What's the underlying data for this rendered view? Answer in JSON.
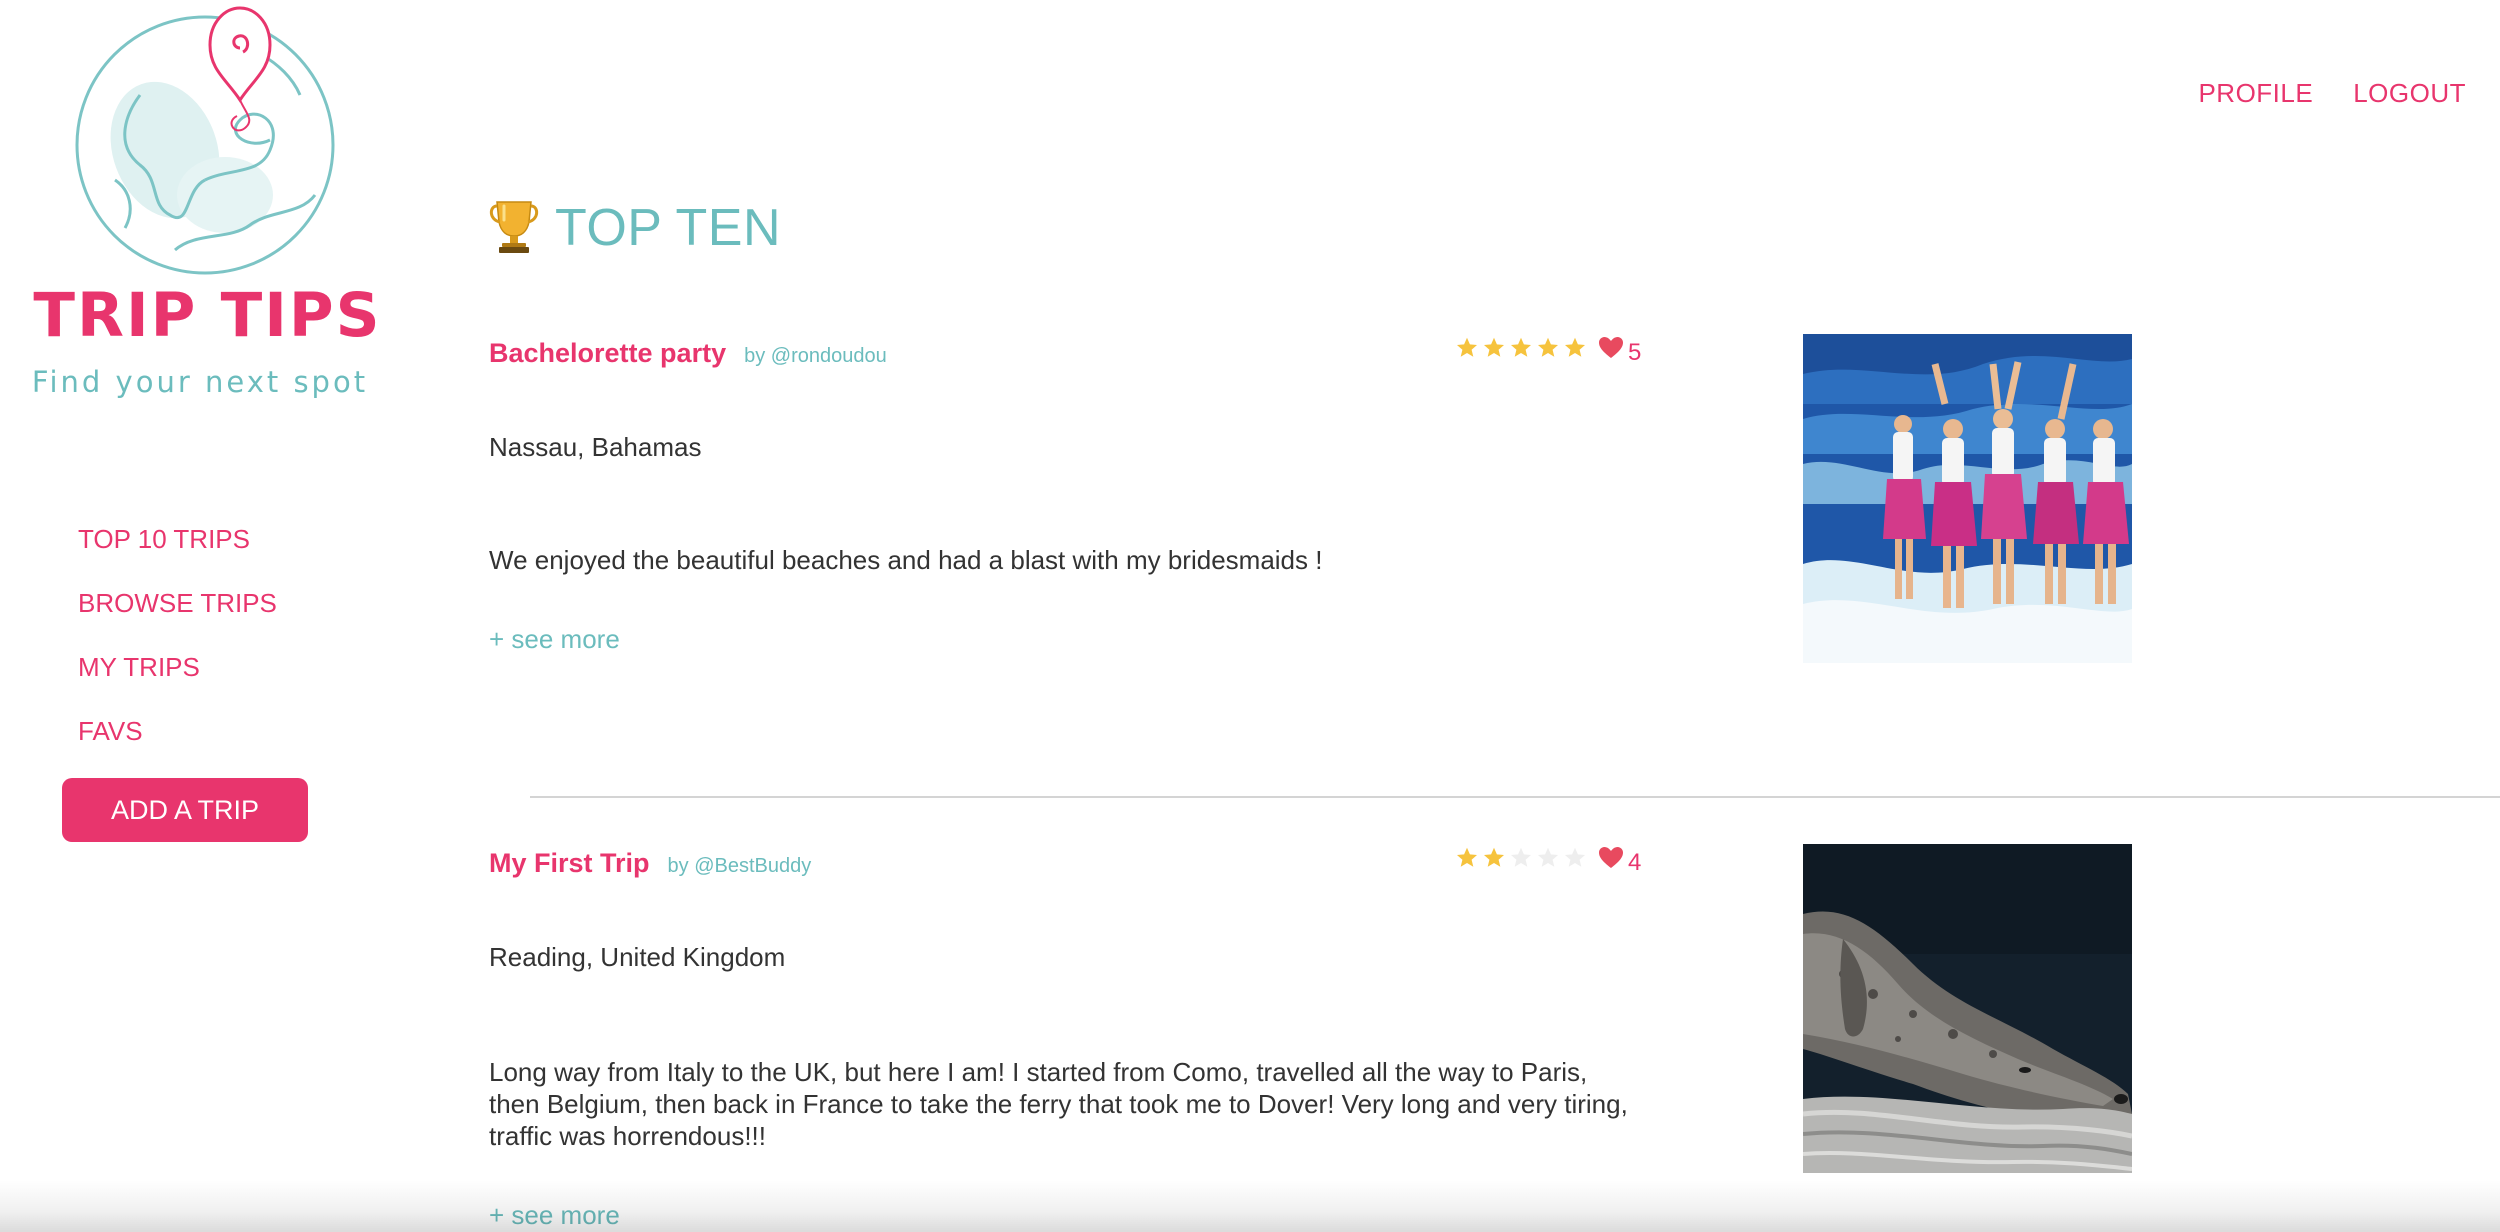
{
  "app": {
    "brand_name": "TRIP TIPS",
    "tagline": "Find your next spot",
    "accent_color": "#e8356d",
    "secondary_color": "#6bbcbd"
  },
  "top_nav": {
    "profile": "PROFILE",
    "logout": "LOGOUT"
  },
  "sidebar": {
    "items": [
      {
        "label": "TOP 10 TRIPS"
      },
      {
        "label": "BROWSE TRIPS"
      },
      {
        "label": "MY TRIPS"
      },
      {
        "label": "FAVS"
      }
    ],
    "add_button": "ADD A TRIP"
  },
  "main": {
    "section_icon": "trophy-icon",
    "section_title": "TOP TEN",
    "trips": [
      {
        "title": "Bachelorette party",
        "author": "by @rondoudou",
        "rating": 5,
        "rating_max": 5,
        "likes": "5",
        "location": "Nassau, Bahamas",
        "description": "We enjoyed the beautiful beaches and had a blast with my bridesmaids !",
        "see_more": "+ see more",
        "photo_icon": "beach-party-photo"
      },
      {
        "title": "My First Trip",
        "author": "by @BestBuddy",
        "rating": 2,
        "rating_max": 5,
        "likes": "4",
        "location": "Reading, United Kingdom",
        "description": "Long way from Italy to the UK, but here I am! I started from Como, travelled all the way to Paris, then Belgium, then back in France to take the ferry that took me to Dover! Very long and very tiring, traffic was horrendous!!!",
        "see_more": "+ see more",
        "photo_icon": "sleeping-dog-photo"
      }
    ]
  }
}
